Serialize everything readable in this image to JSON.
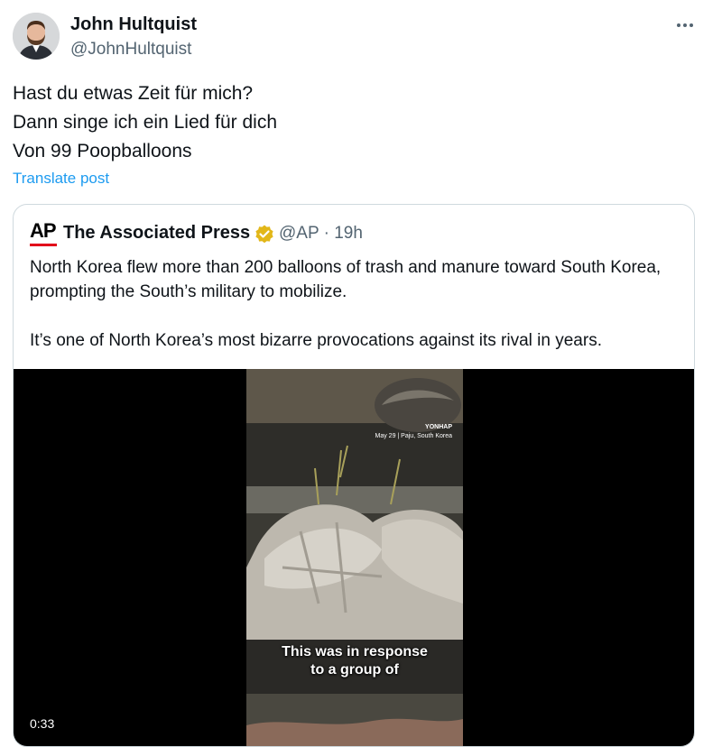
{
  "post": {
    "author_name": "John Hultquist",
    "author_handle": "@JohnHultquist",
    "more_icon": "more-horizontal-icon",
    "text_lines": [
      "Hast du etwas Zeit für mich?",
      "Dann singe ich ein Lied für dich",
      "Von 99 Poopballoons"
    ],
    "translate_label": "Translate post"
  },
  "quote": {
    "logo_letters": "AP",
    "name": "The Associated Press",
    "verified_icon": "verified-gold-badge-icon",
    "handle": "@AP",
    "separator": " · ",
    "time": "19h",
    "paragraphs": [
      "North Korea flew more than 200 balloons of trash and manure toward South Korea, prompting the South’s military to mobilize.",
      "It’s one of North Korea’s most bizarre provocations against its rival in years."
    ],
    "video": {
      "source_brand": "YONHAP",
      "source_location": "May 29 | Paju, South Korea",
      "caption_lines": [
        "This was in response",
        "to a group of"
      ],
      "duration": "0:33"
    }
  },
  "colors": {
    "text_primary": "#0f1419",
    "text_secondary": "#536471",
    "link": "#1d9bf0",
    "border": "#cfd9de",
    "ap_red": "#e2001a",
    "verified_gold": "#e2b719"
  }
}
